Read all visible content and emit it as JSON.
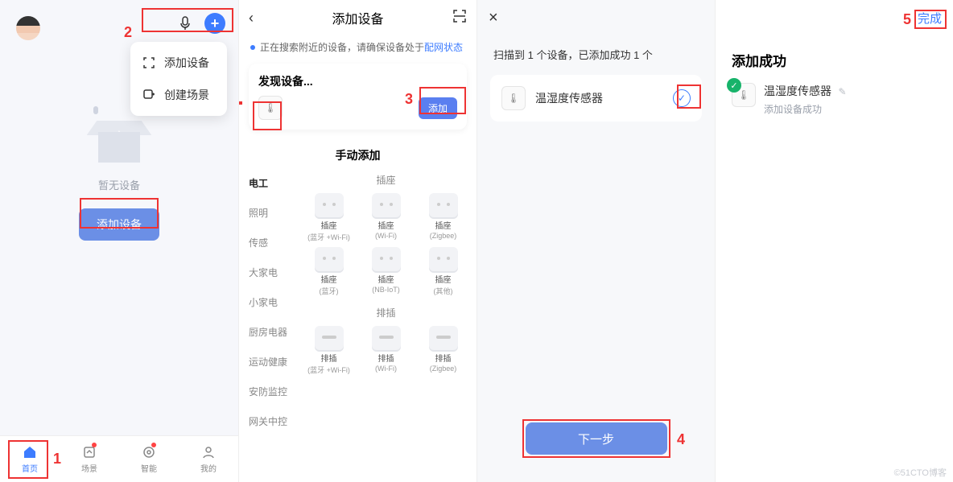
{
  "annotations": {
    "n1": "1",
    "n2": "2",
    "n3": "3",
    "n4": "4",
    "n5": "5"
  },
  "panel1": {
    "empty_text": "暂无设备",
    "add_button": "添加设备",
    "dropdown": {
      "add_device": "添加设备",
      "create_scene": "创建场景"
    },
    "tabs": {
      "home": "首页",
      "scene": "场景",
      "smart": "智能",
      "mine": "我的"
    }
  },
  "panel2": {
    "title": "添加设备",
    "searching": "正在搜索附近的设备，请确保设备处于",
    "link": "配网状态",
    "found_title": "发现设备...",
    "add_chip": "添加",
    "manual_title": "手动添加",
    "categories": [
      "电工",
      "照明",
      "传感",
      "大家电",
      "小家电",
      "厨房电器",
      "运动健康",
      "安防监控",
      "网关中控"
    ],
    "subhead1": "插座",
    "grid1": [
      {
        "nm": "插座",
        "sub": "(蓝牙 +Wi-Fi)"
      },
      {
        "nm": "插座",
        "sub": "(Wi-Fi)"
      },
      {
        "nm": "插座",
        "sub": "(Zigbee)"
      },
      {
        "nm": "插座",
        "sub": "(蓝牙)"
      },
      {
        "nm": "插座",
        "sub": "(NB-IoT)"
      },
      {
        "nm": "插座",
        "sub": "(其他)"
      }
    ],
    "subhead2": "排插",
    "grid2": [
      {
        "nm": "排插",
        "sub": "(蓝牙 +Wi-Fi)"
      },
      {
        "nm": "排插",
        "sub": "(Wi-Fi)"
      },
      {
        "nm": "排插",
        "sub": "(Zigbee)"
      }
    ]
  },
  "panel3": {
    "status": "扫描到 1 个设备，已添加成功 1 个",
    "device": "温湿度传感器",
    "next": "下一步"
  },
  "panel4": {
    "done": "完成",
    "title": "添加成功",
    "device": "温湿度传感器",
    "sub": "添加设备成功"
  },
  "watermark": "©51CTO博客"
}
